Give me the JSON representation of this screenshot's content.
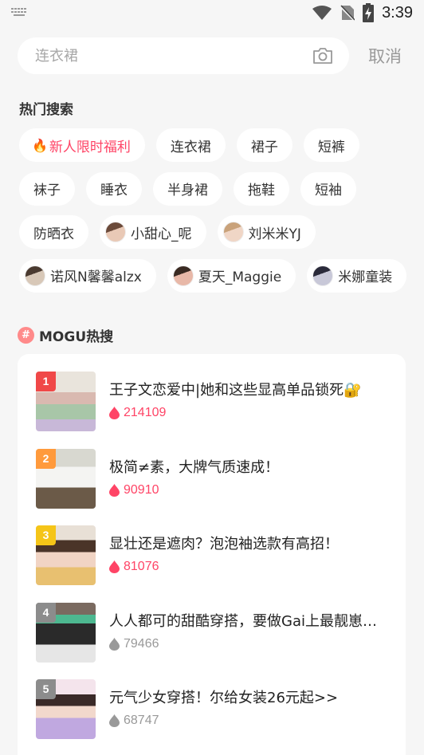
{
  "status_bar": {
    "time": "3:39",
    "icons": [
      "keyboard-icon",
      "wifi-icon",
      "no-sim-icon",
      "battery-charging-icon"
    ]
  },
  "search": {
    "placeholder": "连衣裙",
    "camera_icon": "camera-icon",
    "cancel_label": "取消"
  },
  "hot_search": {
    "title": "热门搜索",
    "rows": [
      [
        {
          "label": "新人限时福利",
          "highlight": true,
          "icon": "fire-icon"
        },
        {
          "label": "连衣裙"
        },
        {
          "label": "裙子"
        },
        {
          "label": "短裤"
        }
      ],
      [
        {
          "label": "袜子"
        },
        {
          "label": "睡衣"
        },
        {
          "label": "半身裙"
        },
        {
          "label": "拖鞋"
        },
        {
          "label": "短袖"
        }
      ],
      [
        {
          "label": "防晒衣"
        },
        {
          "label": "小甜心_呢",
          "avatar": true
        },
        {
          "label": "刘米米YJ",
          "avatar": true
        }
      ],
      [
        {
          "label": "诺风N馨馨alzx",
          "avatar": true
        },
        {
          "label": "夏天_Maggie",
          "avatar": true
        },
        {
          "label": "米娜童装",
          "avatar": true
        }
      ]
    ]
  },
  "mogu_hot": {
    "title": "MOGU热搜",
    "items": [
      {
        "rank": "1",
        "title": "王子文恋爱中|她和这些显高单品锁死🔐",
        "count": "214109",
        "rank_color": "#f04848",
        "count_color": "#ff4466"
      },
      {
        "rank": "2",
        "title": "极简≠素，大牌气质速成！",
        "count": "90910",
        "rank_color": "#ff9a3c",
        "count_color": "#ff4466"
      },
      {
        "rank": "3",
        "title": "显壮还是遮肉？泡泡袖选款有高招！",
        "count": "81076",
        "rank_color": "#f5c518",
        "count_color": "#ff4466"
      },
      {
        "rank": "4",
        "title": "人人都可的甜酷穿搭，要做Gai上最靓崽…",
        "count": "79466",
        "rank_color": "#8c8c8c",
        "count_color": "#999999"
      },
      {
        "rank": "5",
        "title": "元气少女穿搭！尔给女装26元起>>",
        "count": "68747",
        "rank_color": "#8c8c8c",
        "count_color": "#999999"
      }
    ]
  }
}
